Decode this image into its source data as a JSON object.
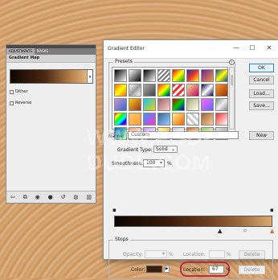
{
  "watermark": "WWW.PSD-DUDE.COM",
  "adjustments_panel": {
    "tabs": [
      "ADJUSTMENTS",
      "MASKS"
    ],
    "title": "Gradient Map",
    "checkbox_dither": "Dither",
    "checkbox_reverse": "Reverse",
    "footer_icons": [
      "return-icon",
      "clip-icon",
      "visibility-icon",
      "view-previous-icon",
      "reset-icon",
      "delete-icon"
    ]
  },
  "dialog": {
    "title": "Gradient Editor",
    "window_controls": {
      "minimize": "—",
      "maximize": "☐",
      "close": "✕"
    },
    "presets_label": "Presets",
    "buttons": {
      "ok": "OK",
      "cancel": "Cancel",
      "load": "Load...",
      "save": "Save...",
      "new": "New"
    },
    "name_label": "Name:",
    "name_value": "Custom",
    "gradient_type_label": "Gradient Type:",
    "gradient_type_value": "Solid",
    "smoothness_label": "Smoothness:",
    "smoothness_value": "100",
    "smoothness_unit": "%",
    "stops": {
      "label": "Stops",
      "opacity_label": "Opacity:",
      "opacity_unit": "%",
      "location_label": "Location:",
      "location_unit": "%",
      "delete_label": "Delete",
      "color_label": "Color:",
      "color_value": "#3a1e0e",
      "location_value": "67"
    }
  },
  "preset_swatches": [
    "linear-gradient(135deg,#000 0%,#fff 100%)",
    "linear-gradient(135deg,#fff 0%,#000 100%)",
    "linear-gradient(135deg,#000 0%,rgba(0,0,0,0) 100%)",
    "repeating-linear-gradient(135deg,#777 0 2px,#fff 2px 4px)",
    "linear-gradient(135deg,#e00 0%,#ff0 50%,#0a0 100%)",
    "linear-gradient(135deg,#2a2aa0 0%,#e33 50%,#ff0 100%)",
    "linear-gradient(135deg,#6a1fa0 0%,#f39a3a 100%)",
    "linear-gradient(135deg,#0a4a9c 0%,#ff0 50%,#0a4a9c 100%)",
    "linear-gradient(135deg,#f60 0%,#ff0 50%,#f60 100%)",
    "linear-gradient(135deg,#fff 0%,#999 50%,#fff 100%)",
    "linear-gradient(135deg,#aaa 0%,#444 100%)",
    "linear-gradient(135deg,#e33 0%,#f90 25%,#ff0 50%,#0c0 75%,#00f 100%)",
    "repeating-linear-gradient(135deg,#e33 0 3px,#fff 3px 6px)",
    "linear-gradient(135deg,#f0e68c 0%,#c06 100%)",
    "linear-gradient(135deg,#004 0%,#fff 50%,#004 100%)",
    "linear-gradient(135deg,#f93 0%,#930 100%)",
    "linear-gradient(135deg,#c9c 0%,#36c 100%)",
    "linear-gradient(135deg,#fc0 0%,#933 100%)",
    "linear-gradient(135deg,#0cf 0%,#fc0 100%)",
    "linear-gradient(135deg,#966 0%,#fcc 100%)",
    "linear-gradient(135deg,#c00 0%,#0c0 50%,#00c 100%)",
    "linear-gradient(135deg,#aa7 0%,#ffe 100%)",
    "linear-gradient(135deg,#f6f 0%,#66f 100%)",
    "linear-gradient(135deg,#888 0%,#eee 50%,#888 100%)",
    "linear-gradient(135deg,#f00 0%,#ff0 20%,#0f0 40%,#0ff 60%,#00f 80%,#f0f 100%)",
    "linear-gradient(135deg,#fc6 0%,#f93 100%)",
    "linear-gradient(135deg,#39f 0%,#f3c 100%)",
    "linear-gradient(135deg,#369 0%,#9cf 100%)",
    "linear-gradient(135deg,#fe8 0%,#e60 100%)",
    "repeating-linear-gradient(45deg,#ccc 0 3px,#fff 3px 6px)",
    "linear-gradient(135deg,#963 0%,#fc9 100%)",
    "linear-gradient(135deg,#e33 0%,#fff 100%)",
    "linear-gradient(135deg,#06c 0%,#9f9 100%)",
    "linear-gradient(135deg,#f96 0%,#fff 100%)",
    "linear-gradient(135deg,#c9f 0%,#fff 100%)",
    "linear-gradient(135deg,#ff9 0%,#f90 100%)",
    "linear-gradient(135deg,#ccc 0%,#fff 100%)",
    "linear-gradient(135deg,#c63 0%,#ff9 100%)",
    "linear-gradient(135deg,#9c6 0%,#ffc 100%)",
    "linear-gradient(135deg,#ddd 0%,#999 100%)"
  ]
}
